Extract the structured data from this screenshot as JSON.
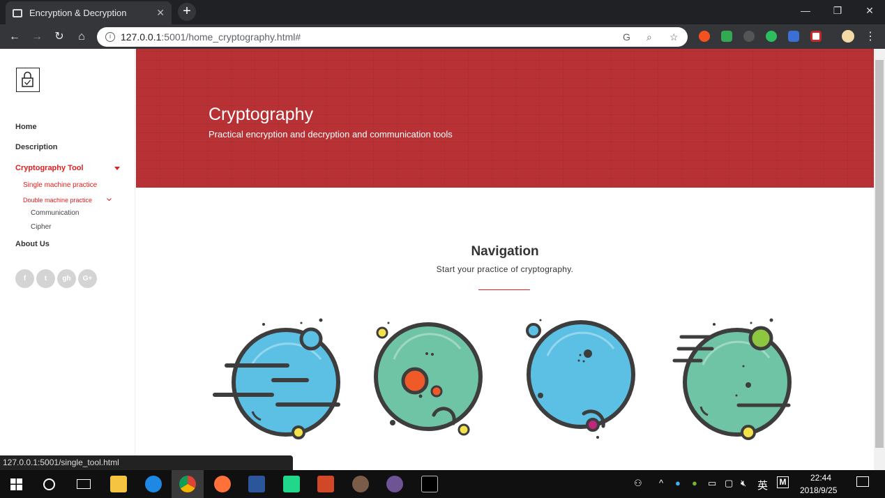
{
  "browser": {
    "tab_title": "Encryption & Decryption",
    "url_host": "127.0.0.1",
    "url_path": ":5001/home_cryptography.html#",
    "status_url": "127.0.0.1:5001/single_tool.html"
  },
  "sidebar": {
    "items": [
      "Home",
      "Description",
      "Cryptography Tool",
      "About Us"
    ],
    "sub_single": "Single machine practice",
    "sub_double": "Double machine practice",
    "sub_communication": "Communication",
    "sub_cipher": "Cipher",
    "social": [
      "f",
      "t",
      "gh",
      "G+"
    ]
  },
  "hero": {
    "title": "Cryptography",
    "subtitle": "Practical encryption and decryption and communication tools"
  },
  "navigation": {
    "title": "Navigation",
    "subtitle": "Start your practice of cryptography."
  },
  "taskbar": {
    "ime": "英",
    "time": "22:44",
    "date": "2018/9/25"
  },
  "colors": {
    "accent": "#e31c1c",
    "hero": "#b83235",
    "planet_blue": "#5bc0e3",
    "planet_green": "#6ec4a4"
  }
}
